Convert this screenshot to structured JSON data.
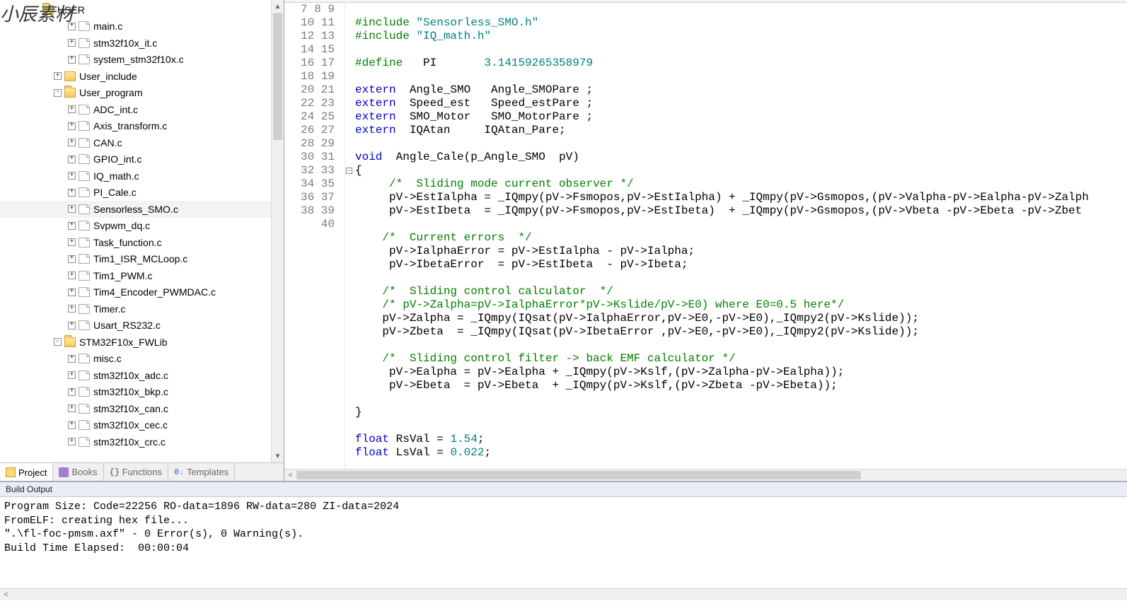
{
  "watermark": "小辰素材",
  "tree": {
    "root_label": "USER",
    "nodes": [
      {
        "kind": "file",
        "depth": 3,
        "name": "main.c"
      },
      {
        "kind": "file",
        "depth": 3,
        "name": "stm32f10x_it.c"
      },
      {
        "kind": "file",
        "depth": 3,
        "name": "system_stm32f10x.c"
      },
      {
        "kind": "folder",
        "depth": 2,
        "name": "User_include",
        "toggle": "+"
      },
      {
        "kind": "folder",
        "depth": 2,
        "name": "User_program",
        "toggle": "-",
        "open": true
      },
      {
        "kind": "file",
        "depth": 3,
        "name": "ADC_int.c"
      },
      {
        "kind": "file",
        "depth": 3,
        "name": "Axis_transform.c"
      },
      {
        "kind": "file",
        "depth": 3,
        "name": "CAN.c"
      },
      {
        "kind": "file",
        "depth": 3,
        "name": "GPIO_int.c"
      },
      {
        "kind": "file",
        "depth": 3,
        "name": "IQ_math.c"
      },
      {
        "kind": "file",
        "depth": 3,
        "name": "PI_Cale.c"
      },
      {
        "kind": "file",
        "depth": 3,
        "name": "Sensorless_SMO.c",
        "selected": true
      },
      {
        "kind": "file",
        "depth": 3,
        "name": "Svpwm_dq.c"
      },
      {
        "kind": "file",
        "depth": 3,
        "name": "Task_function.c"
      },
      {
        "kind": "file",
        "depth": 3,
        "name": "Tim1_ISR_MCLoop.c"
      },
      {
        "kind": "file",
        "depth": 3,
        "name": "Tim1_PWM.c"
      },
      {
        "kind": "file",
        "depth": 3,
        "name": "Tim4_Encoder_PWMDAC.c"
      },
      {
        "kind": "file",
        "depth": 3,
        "name": "Timer.c"
      },
      {
        "kind": "file",
        "depth": 3,
        "name": "Usart_RS232.c"
      },
      {
        "kind": "folder",
        "depth": 2,
        "name": "STM32F10x_FWLib",
        "toggle": "-",
        "open": true
      },
      {
        "kind": "file",
        "depth": 3,
        "name": "misc.c"
      },
      {
        "kind": "file",
        "depth": 3,
        "name": "stm32f10x_adc.c"
      },
      {
        "kind": "file",
        "depth": 3,
        "name": "stm32f10x_bkp.c"
      },
      {
        "kind": "file",
        "depth": 3,
        "name": "stm32f10x_can.c"
      },
      {
        "kind": "file",
        "depth": 3,
        "name": "stm32f10x_cec.c"
      },
      {
        "kind": "file",
        "depth": 3,
        "name": "stm32f10x_crc.c"
      }
    ]
  },
  "proj_tabs": {
    "project": "Project",
    "books": "Books",
    "functions": "Functions",
    "templates": "Templates"
  },
  "editor": {
    "first_line": 7,
    "lines": [
      {
        "n": 7,
        "html": ""
      },
      {
        "n": 8,
        "html": "<span class='tok-pp'>#include</span> <span class='tok-str'>\"Sensorless_SMO.h\"</span>"
      },
      {
        "n": 9,
        "html": "<span class='tok-pp'>#include</span> <span class='tok-str'>\"IQ_math.h\"</span>"
      },
      {
        "n": 10,
        "html": ""
      },
      {
        "n": 11,
        "html": "<span class='tok-pp'>#define</span>   PI       <span class='tok-num'>3.14159265358979</span>"
      },
      {
        "n": 12,
        "html": ""
      },
      {
        "n": 13,
        "html": "<span class='tok-kw'>extern</span>  Angle_SMO   Angle_SMOPare ;"
      },
      {
        "n": 14,
        "html": "<span class='tok-kw'>extern</span>  Speed_est   Speed_estPare ;"
      },
      {
        "n": 15,
        "html": "<span class='tok-kw'>extern</span>  SMO_Motor   SMO_MotorPare ;"
      },
      {
        "n": 16,
        "html": "<span class='tok-kw'>extern</span>  IQAtan     IQAtan_Pare;"
      },
      {
        "n": 17,
        "html": ""
      },
      {
        "n": 18,
        "html": "<span class='tok-kw'>void</span>  Angle_Cale(p_Angle_SMO  pV)"
      },
      {
        "n": 19,
        "html": "{",
        "fold": "-"
      },
      {
        "n": 20,
        "html": "     <span class='tok-cmt'>/*  Sliding mode current observer */</span>"
      },
      {
        "n": 21,
        "html": "     pV-&gt;EstIalpha = _IQmpy(pV-&gt;Fsmopos,pV-&gt;EstIalpha) + _IQmpy(pV-&gt;Gsmopos,(pV-&gt;Valpha-pV-&gt;Ealpha-pV-&gt;Zalph"
      },
      {
        "n": 22,
        "html": "     pV-&gt;EstIbeta  = _IQmpy(pV-&gt;Fsmopos,pV-&gt;EstIbeta)  + _IQmpy(pV-&gt;Gsmopos,(pV-&gt;Vbeta -pV-&gt;Ebeta -pV-&gt;Zbet"
      },
      {
        "n": 23,
        "html": ""
      },
      {
        "n": 24,
        "html": "    <span class='tok-cmt'>/*  Current errors  */</span>"
      },
      {
        "n": 25,
        "html": "     pV-&gt;IalphaError = pV-&gt;EstIalpha - pV-&gt;Ialpha;"
      },
      {
        "n": 26,
        "html": "     pV-&gt;IbetaError  = pV-&gt;EstIbeta  - pV-&gt;Ibeta;"
      },
      {
        "n": 27,
        "html": ""
      },
      {
        "n": 28,
        "html": "    <span class='tok-cmt'>/*  Sliding control calculator  */</span>"
      },
      {
        "n": 29,
        "html": "    <span class='tok-cmt'>/* pV-&gt;Zalpha=pV-&gt;IalphaError*pV-&gt;Kslide/pV-&gt;E0) where E0=0.5 here*/</span>"
      },
      {
        "n": 30,
        "html": "    pV-&gt;Zalpha = _IQmpy(IQsat(pV-&gt;IalphaError,pV-&gt;E0,-pV-&gt;E0),_IQmpy2(pV-&gt;Kslide));"
      },
      {
        "n": 31,
        "html": "    pV-&gt;Zbeta  = _IQmpy(IQsat(pV-&gt;IbetaError ,pV-&gt;E0,-pV-&gt;E0),_IQmpy2(pV-&gt;Kslide));"
      },
      {
        "n": 32,
        "html": ""
      },
      {
        "n": 33,
        "html": "    <span class='tok-cmt'>/*  Sliding control filter -&gt; back EMF calculator */</span>"
      },
      {
        "n": 34,
        "html": "     pV-&gt;Ealpha = pV-&gt;Ealpha + _IQmpy(pV-&gt;Kslf,(pV-&gt;Zalpha-pV-&gt;Ealpha));"
      },
      {
        "n": 35,
        "html": "     pV-&gt;Ebeta  = pV-&gt;Ebeta  + _IQmpy(pV-&gt;Kslf,(pV-&gt;Zbeta -pV-&gt;Ebeta));"
      },
      {
        "n": 36,
        "html": ""
      },
      {
        "n": 37,
        "html": "}"
      },
      {
        "n": 38,
        "html": ""
      },
      {
        "n": 39,
        "html": "<span class='tok-kw'>float</span> RsVal = <span class='tok-num'>1.54</span>;"
      },
      {
        "n": 40,
        "html": "<span class='tok-kw'>float</span> LsVal = <span class='tok-num'>0.022</span>;"
      }
    ]
  },
  "build_output": {
    "title": "Build Output",
    "lines": [
      "Program Size: Code=22256 RO-data=1896 RW-data=280 ZI-data=2024",
      "FromELF: creating hex file...",
      "\".\\fl-foc-pmsm.axf\" - 0 Error(s), 0 Warning(s).",
      "Build Time Elapsed:  00:00:04"
    ]
  }
}
